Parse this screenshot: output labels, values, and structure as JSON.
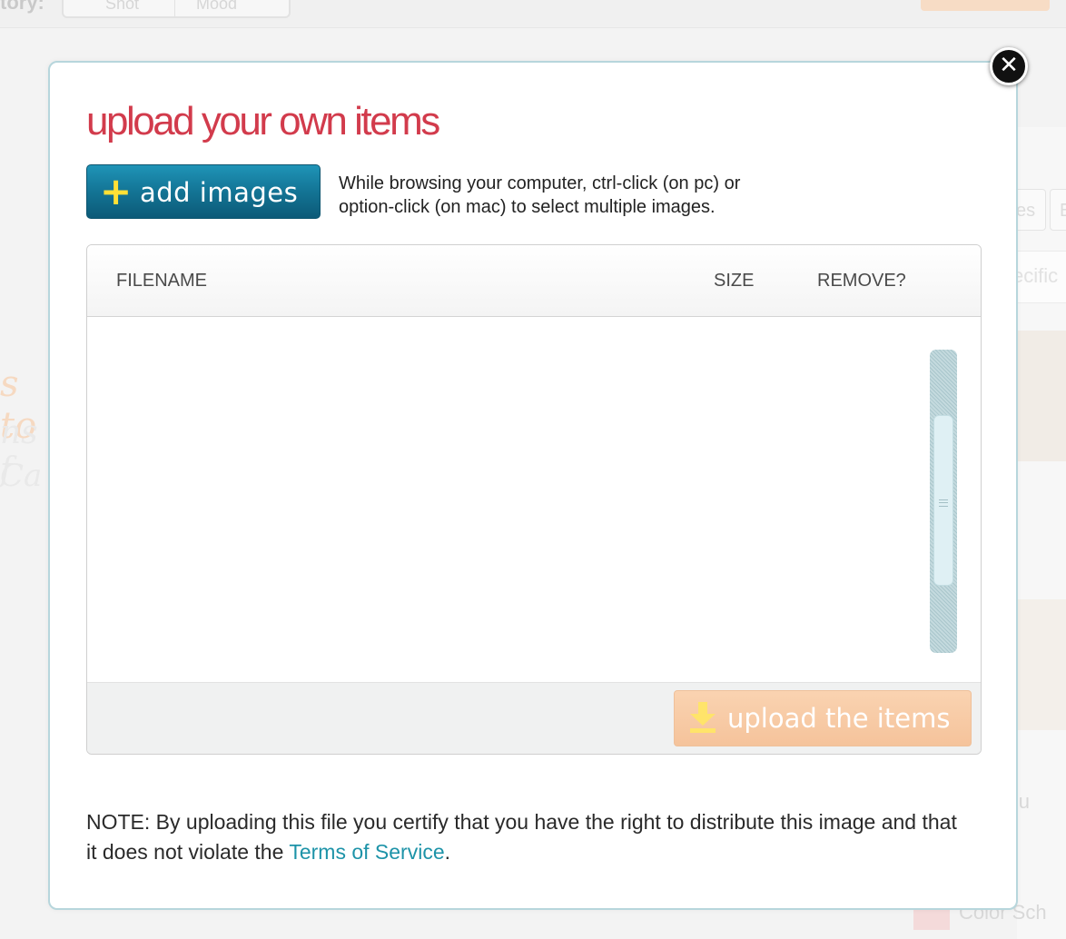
{
  "background": {
    "category_label": "tory:",
    "segment_left": "Shot",
    "segment_right": "Mood",
    "scribble_1": "s to",
    "scribble_2": "ns f",
    "scribble_3": "Ca",
    "tab_1": "es",
    "tab_2": "E",
    "search_placeholder": "ecific",
    "label_grou": "grou",
    "label_color": "Color Sch"
  },
  "modal": {
    "title": "upload your own items",
    "close_icon": "close-icon",
    "add_button": {
      "icon": "plus-icon",
      "label": "add images"
    },
    "hint_line1": "While browsing your computer, ctrl-click (on pc) or",
    "hint_line2": "option-click (on mac) to select multiple images.",
    "table": {
      "columns": {
        "filename": "FILENAME",
        "size": "SIZE",
        "remove": "REMOVE?"
      },
      "rows": []
    },
    "upload_button": {
      "icon": "download-icon",
      "label": "upload the items"
    },
    "note_text": "NOTE: By uploading this file you certify that you have the right to distribute this image and that it does not violate the ",
    "terms_link": "Terms of Service",
    "note_end": "."
  },
  "colors": {
    "title": "#d23b4c",
    "add_button": "#137495",
    "upload_button": "#f5c39b",
    "link": "#1d93a8",
    "modal_border": "#b7d6dc"
  }
}
